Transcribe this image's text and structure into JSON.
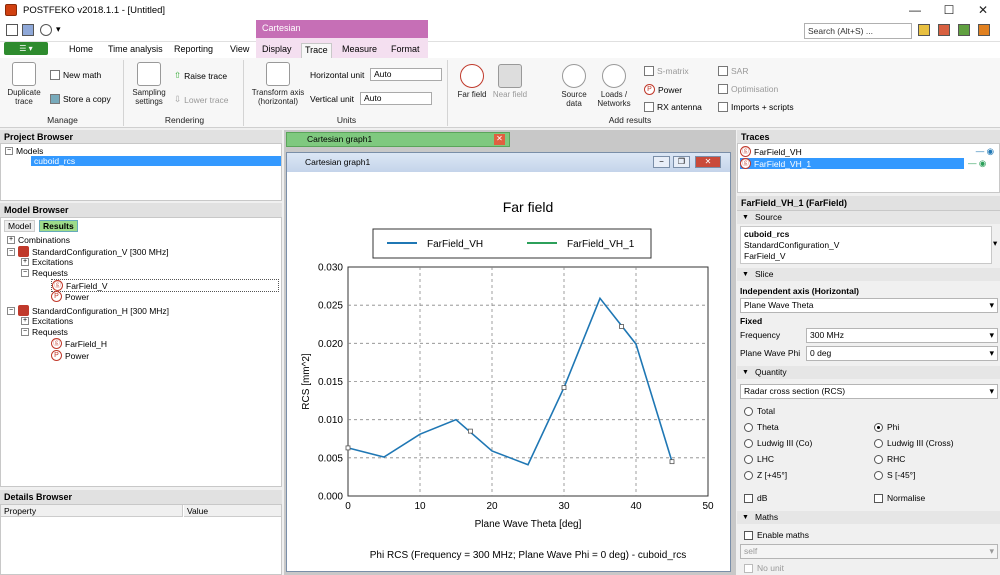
{
  "window": {
    "title": "POSTFEKO v2018.1.1 - [Untitled]",
    "minimize": "—",
    "maximize": "☐",
    "close": "✕"
  },
  "search": {
    "placeholder": "Search (Alt+S) ..."
  },
  "tabs": {
    "contextual": "Cartesian",
    "items": [
      "Home",
      "Time analysis",
      "Reporting",
      "View",
      "Display",
      "Trace",
      "Measure",
      "Format"
    ],
    "active": "Trace"
  },
  "ribbon": {
    "manage": {
      "label": "Manage",
      "duplicate": "Duplicate trace",
      "new_math": "New math",
      "store_copy": "Store a copy"
    },
    "rendering": {
      "label": "Rendering",
      "sampling": "Sampling settings",
      "raise": "Raise trace",
      "lower": "Lower trace"
    },
    "units": {
      "label": "Units",
      "transform": "Transform axis (horizontal)",
      "h_unit_label": "Horizontal unit",
      "h_unit_value": "Auto",
      "v_unit_label": "Vertical unit",
      "v_unit_value": "Auto"
    },
    "add_results": {
      "label": "Add results",
      "far_field": "Far field",
      "near_field": "Near field",
      "source_data": "Source data",
      "loads": "Loads / Networks",
      "s_matrix": "S-matrix",
      "power": "Power",
      "rx_antenna": "RX antenna",
      "sar": "SAR",
      "optimisation": "Optimisation",
      "imports": "Imports + scripts"
    }
  },
  "project_browser": {
    "title": "Project Browser",
    "root": "Models",
    "model": "cuboid_rcs"
  },
  "model_browser": {
    "title": "Model Browser",
    "tab_model": "Model",
    "tab_results": "Results",
    "items": [
      "Combinations",
      "StandardConfiguration_V [300 MHz]",
      "Excitations",
      "Requests",
      "FarField_V",
      "Power",
      "StandardConfiguration_H [300 MHz]",
      "Excitations",
      "Requests",
      "FarField_H",
      "Power"
    ]
  },
  "details_browser": {
    "title": "Details Browser",
    "col_property": "Property",
    "col_value": "Value"
  },
  "graph": {
    "doc_tab": "Cartesian graph1",
    "window_title": "Cartesian graph1"
  },
  "chart_data": {
    "type": "line",
    "title": "Far field",
    "xlabel": "Plane Wave Theta [deg]",
    "ylabel": "RCS [mm^2]",
    "caption": "Phi RCS (Frequency = 300 MHz; Plane Wave Phi = 0 deg) - cuboid_rcs",
    "xlim": [
      0,
      50
    ],
    "ylim": [
      0,
      0.03
    ],
    "xticks": [
      "0",
      "10",
      "20",
      "30",
      "40",
      "50"
    ],
    "yticks": [
      "0.000",
      "0.005",
      "0.010",
      "0.015",
      "0.020",
      "0.025",
      "0.030"
    ],
    "grid": true,
    "legend": "top",
    "series": [
      {
        "name": "FarField_VH",
        "color": "#1f77b4",
        "x": [
          0,
          5,
          10,
          15,
          20,
          25,
          30,
          35,
          40,
          45
        ],
        "y": [
          0.0063,
          0.0051,
          0.0081,
          0.01,
          0.0059,
          0.0041,
          0.0142,
          0.0259,
          0.0199,
          0.0045
        ]
      },
      {
        "name": "FarField_VH_1",
        "color": "#2ca05a",
        "x": [],
        "y": []
      }
    ],
    "markers": {
      "x": [
        0,
        17,
        30,
        38,
        45
      ],
      "y": [
        0.0063,
        0.0085,
        0.0142,
        0.0222,
        0.0045
      ]
    }
  },
  "traces": {
    "title": "Traces",
    "items": [
      "FarField_VH",
      "FarField_VH_1"
    ]
  },
  "properties": {
    "header": "FarField_VH_1 (FarField)",
    "source_section": "Source",
    "source_name": "cuboid_rcs",
    "source_config": "StandardConfiguration_V",
    "source_request": "FarField_V",
    "slice_section": "Slice",
    "independent_axis_label": "Independent axis (Horizontal)",
    "independent_axis_value": "Plane Wave Theta",
    "fixed_label": "Fixed",
    "frequency_label": "Frequency",
    "frequency_value": "300 MHz",
    "phi_label": "Plane Wave Phi",
    "phi_value": "0 deg",
    "quantity_section": "Quantity",
    "quantity_value": "Radar cross section (RCS)",
    "radios": [
      "Total",
      "Theta",
      "Phi",
      "Ludwig III (Co)",
      "Ludwig III (Cross)",
      "LHC",
      "RHC",
      "Z [+45°]",
      "S [-45°]"
    ],
    "selected_radio": "Phi",
    "db_label": "dB",
    "normalise_label": "Normalise",
    "maths_section": "Maths",
    "enable_maths": "Enable maths",
    "maths_expr": "self",
    "no_unit": "No unit"
  }
}
